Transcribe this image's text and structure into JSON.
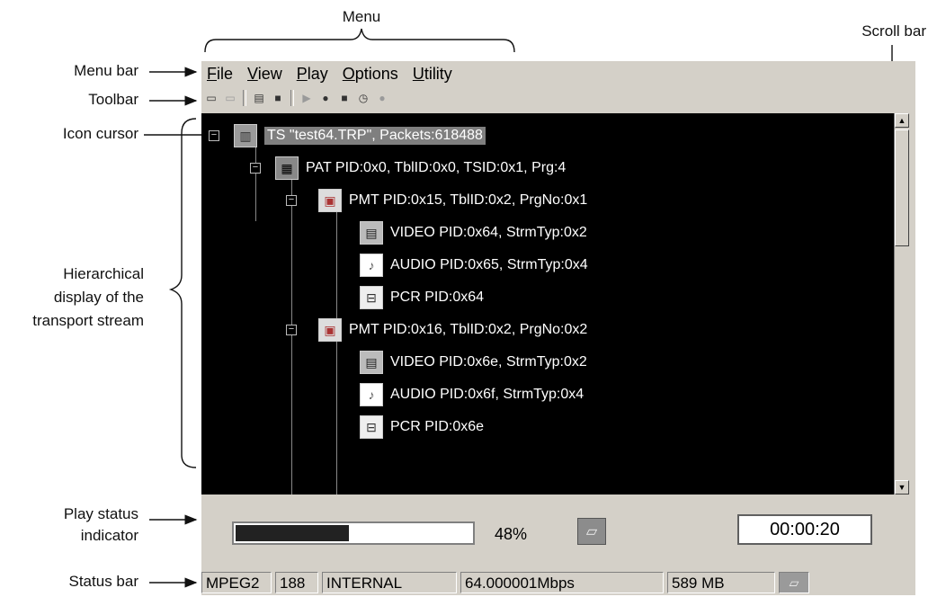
{
  "annotations": {
    "menu": "Menu",
    "scroll_bar": "Scroll bar",
    "menu_bar": "Menu bar",
    "toolbar": "Toolbar",
    "icon_cursor": "Icon cursor",
    "hierarchical_line1": "Hierarchical",
    "hierarchical_line2": "display of the",
    "hierarchical_line3": "transport stream",
    "play_status_line1": "Play status",
    "play_status_line2": "indicator",
    "status_bar": "Status bar"
  },
  "menubar": {
    "file": {
      "first": "F",
      "rest": "ile"
    },
    "view": {
      "first": "V",
      "rest": "iew"
    },
    "play": {
      "first": "P",
      "rest": "lay"
    },
    "options": {
      "first": "O",
      "rest": "ptions"
    },
    "utility": {
      "first": "U",
      "rest": "tility"
    }
  },
  "toolbar": {
    "icons": [
      "open-icon",
      "close-folder-icon",
      "open-file-icon",
      "save-icon",
      "play-icon",
      "record-icon",
      "stop-icon",
      "timer-icon",
      "stop-circle-icon"
    ]
  },
  "tree": {
    "ts": "TS \"test64.TRP\", Packets:618488",
    "pat": "PAT PID:0x0, TblID:0x0, TSID:0x1, Prg:4",
    "pmt1": "PMT PID:0x15, TblID:0x2, PrgNo:0x1",
    "video1": "VIDEO PID:0x64, StrmTyp:0x2",
    "audio1": "AUDIO PID:0x65, StrmTyp:0x4",
    "pcr1": "PCR PID:0x64",
    "pmt2": "PMT PID:0x16, TblID:0x2, PrgNo:0x2",
    "video2": "VIDEO PID:0x6e, StrmTyp:0x2",
    "audio2": "AUDIO PID:0x6f, StrmTyp:0x4",
    "pcr2": "PCR PID:0x6e"
  },
  "play_status": {
    "progress": 0.48,
    "percent_text": "48%",
    "time": "00:00:20"
  },
  "statusbar": {
    "format": "MPEG2",
    "packet_size": "188",
    "clock": "INTERNAL",
    "rate": "64.000001Mbps",
    "size": "589 MB"
  }
}
